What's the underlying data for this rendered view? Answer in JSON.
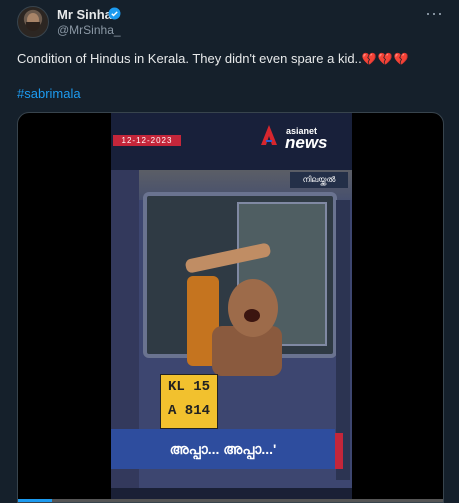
{
  "author": {
    "name": "Mr Sinha",
    "handle": "@MrSinha_"
  },
  "more_label": "⋯",
  "tweet": {
    "text": "Condition of Hindus in Kerala. They didn't even spare a kid..",
    "hearts": "💔💔💔",
    "hashtag": "#sabrimala"
  },
  "video": {
    "date": "12-12-2023",
    "channel_top": "asianet",
    "channel_bottom": "news",
    "tag": "നിലയ്ക്കൽ",
    "plate_line1": "KL 15",
    "plate_line2": "A 814",
    "caption": "അപ്പാ... അപ്പാ...'",
    "progress": 0.08
  },
  "colors": {
    "accent": "#1d9bf0",
    "background": "#15202b",
    "heart": "#e0245e"
  }
}
